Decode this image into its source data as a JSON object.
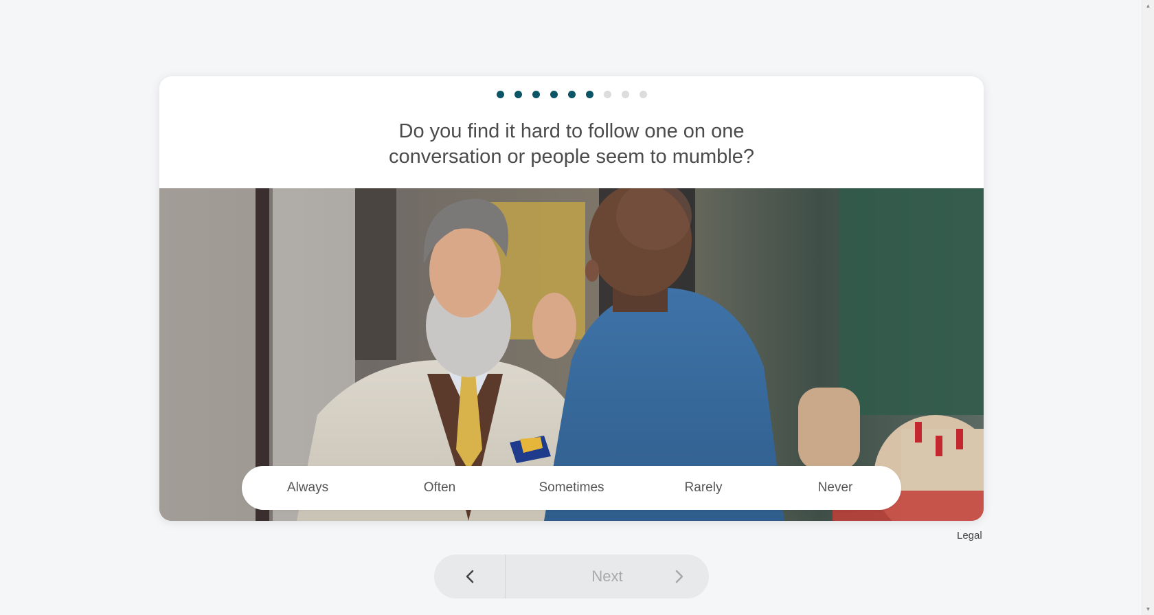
{
  "progress": {
    "total_steps": 9,
    "completed_steps": 6
  },
  "question": {
    "text": "Do you find it hard to follow one on one conversation or people seem to mumble?"
  },
  "image": {
    "subject": "Two people having a one-on-one conversation at an outdoor cafe"
  },
  "answers": [
    {
      "label": "Always"
    },
    {
      "label": "Often"
    },
    {
      "label": "Sometimes"
    },
    {
      "label": "Rarely"
    },
    {
      "label": "Never"
    }
  ],
  "footer": {
    "legal_label": "Legal"
  },
  "navigation": {
    "back_icon": "chevron-left-icon",
    "next_label": "Next",
    "next_icon": "chevron-right-icon",
    "next_enabled": false
  },
  "colors": {
    "accent": "#0b5566",
    "inactive_dot": "#dcdcdc",
    "background": "#f5f6f8"
  }
}
